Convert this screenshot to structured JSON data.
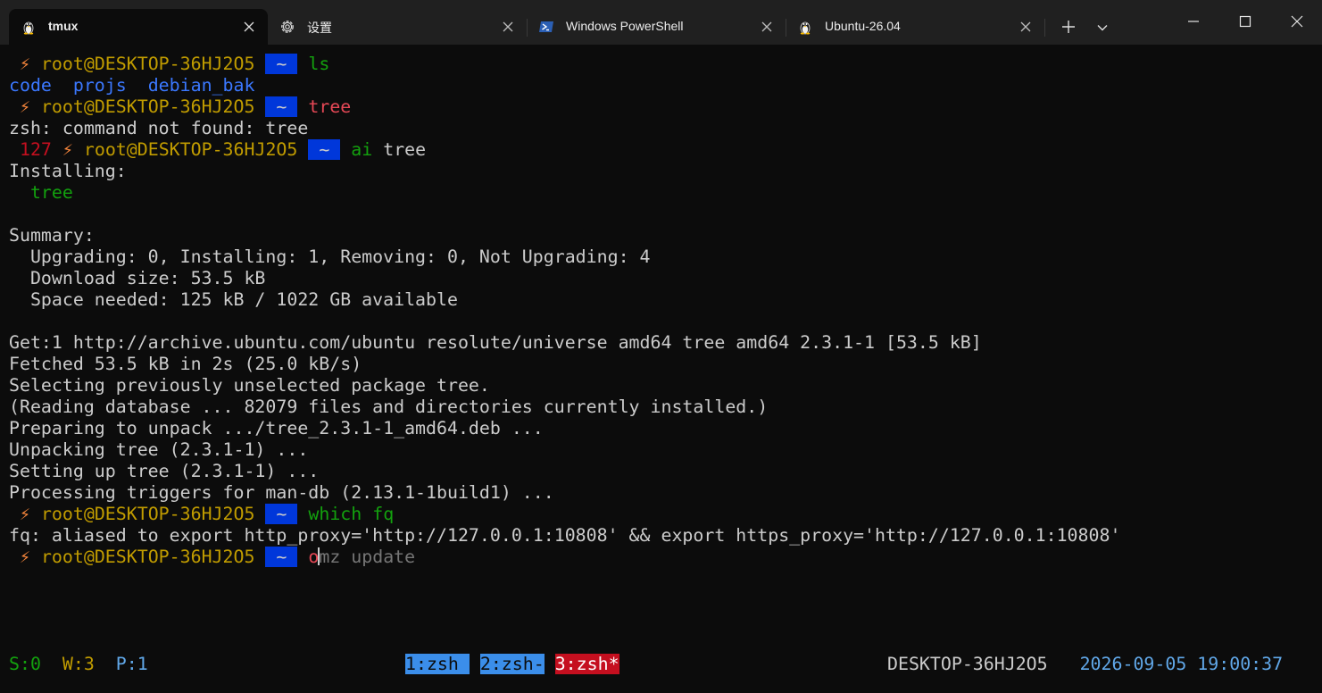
{
  "tabs": [
    {
      "label": "tmux",
      "icon": "linux-penguin-icon",
      "active": true
    },
    {
      "label": "设置",
      "icon": "gear-icon",
      "active": false
    },
    {
      "label": "Windows PowerShell",
      "icon": "powershell-icon",
      "active": false
    },
    {
      "label": "Ubuntu-26.04",
      "icon": "linux-penguin-icon",
      "active": false
    }
  ],
  "prompt": {
    "bolt": "⚡",
    "user_host": "root@DESKTOP-36HJ2O5",
    "dir": " ~ ",
    "dir_edge": "",
    "exit_code": "127"
  },
  "terminal": {
    "cmd1": "ls",
    "ls_out": [
      "code",
      "projs",
      "debian_bak"
    ],
    "cmd2": "tree",
    "not_found": "zsh: command not found: tree",
    "cmd3_name": "ai",
    "cmd3_arg": "tree",
    "installing": "Installing:",
    "pkg": "tree",
    "summary": "Summary:",
    "summary_line1": "Upgrading: 0, Installing: 1, Removing: 0, Not Upgrading: 4",
    "summary_line2": "Download size: 53.5 kB",
    "summary_line3": "Space needed: 125 kB / 1022 GB available",
    "get1": "Get:1 http://archive.ubuntu.com/ubuntu resolute/universe amd64 tree amd64 2.3.1-1 [53.5 kB]",
    "fetched": "Fetched 53.5 kB in 2s (25.0 kB/s)",
    "selecting": "Selecting previously unselected package tree.",
    "reading": "(Reading database ... 82079 files and directories currently installed.)",
    "preparing": "Preparing to unpack .../tree_2.3.1-1_amd64.deb ...",
    "unpacking": "Unpacking tree (2.3.1-1) ...",
    "setting_up": "Setting up tree (2.3.1-1) ...",
    "processing": "Processing triggers for man-db (2.13.1-1build1) ...",
    "cmd4": "which fq",
    "fq_out": "fq: aliased to export http_proxy='http://127.0.0.1:10808' && export https_proxy='http://127.0.0.1:10808'",
    "cmd5_typed": "o",
    "cmd5_suggest": "mz update"
  },
  "status_bar": {
    "session": "S:0",
    "window": "W:3",
    "pane": "P:1",
    "windows": [
      "1:zsh ",
      "2:zsh-",
      "3:zsh*"
    ],
    "host": "DESKTOP-36HJ2O5",
    "datetime": "2026-09-05 19:00:37"
  }
}
